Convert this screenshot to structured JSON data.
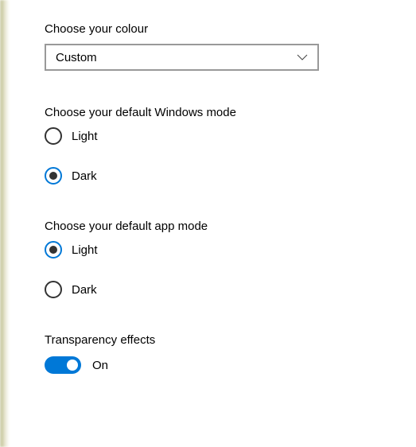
{
  "accent": "#0078d7",
  "colour": {
    "label": "Choose your colour",
    "selected": "Custom"
  },
  "windowsMode": {
    "label": "Choose your default Windows mode",
    "options": [
      "Light",
      "Dark"
    ],
    "selected": "Dark"
  },
  "appMode": {
    "label": "Choose your default app mode",
    "options": [
      "Light",
      "Dark"
    ],
    "selected": "Light"
  },
  "transparency": {
    "label": "Transparency effects",
    "state": "On"
  }
}
